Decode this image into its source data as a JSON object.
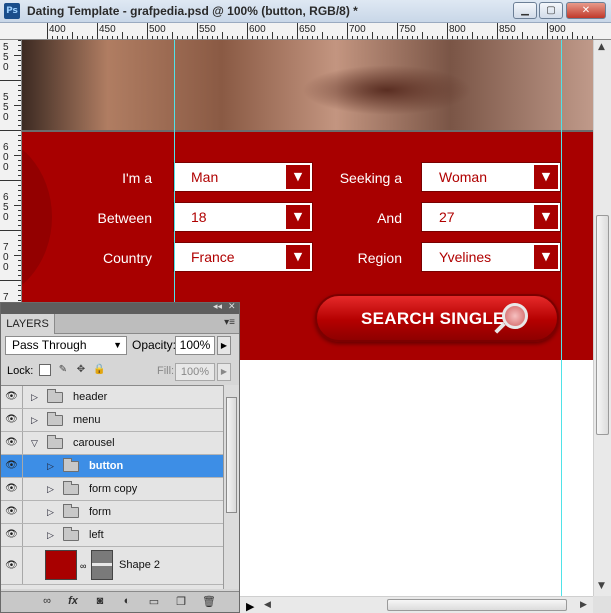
{
  "window": {
    "app_icon": "Ps",
    "title": "Dating Template - grafpedia.psd @ 100% (button, RGB/8) *",
    "controls": [
      "minimize-icon",
      "maximize-icon",
      "close-icon"
    ]
  },
  "ruler": {
    "top_labels": [
      "400",
      "450",
      "500",
      "550",
      "600",
      "650",
      "700",
      "750",
      "800",
      "850",
      "900"
    ],
    "left_labels": [
      "5",
      "5",
      "0",
      "5",
      "5",
      "0",
      "6",
      "0",
      "0",
      "6",
      "5",
      "0",
      "7",
      "0",
      "0",
      "7",
      "5",
      "0"
    ]
  },
  "form": {
    "iam_label": "I'm a",
    "iam_value": "Man",
    "seeking_label": "Seeking a",
    "seeking_value": "Woman",
    "between_label": "Between",
    "between_value": "18",
    "and_label": "And",
    "and_value": "27",
    "country_label": "Country",
    "country_value": "France",
    "region_label": "Region",
    "region_value": "Yvelines",
    "search_button": "SEARCH SINGLE"
  },
  "colors": {
    "panel_red": "#a80000",
    "guide": "#4fe3e8",
    "layer_selected": "#3d8ee6"
  },
  "layers_panel": {
    "tab": "LAYERS",
    "blend_mode": "Pass Through",
    "opacity_label": "Opacity:",
    "opacity_value": "100%",
    "lock_label": "Lock:",
    "fill_label": "Fill:",
    "fill_value": "100%",
    "layers": [
      {
        "name": "header",
        "type": "group",
        "expanded": false,
        "indent": 0,
        "selected": false
      },
      {
        "name": "menu",
        "type": "group",
        "expanded": false,
        "indent": 0,
        "selected": false
      },
      {
        "name": "carousel",
        "type": "group",
        "expanded": true,
        "indent": 0,
        "selected": false
      },
      {
        "name": "button",
        "type": "group",
        "expanded": false,
        "indent": 1,
        "selected": true
      },
      {
        "name": "form copy",
        "type": "group",
        "expanded": false,
        "indent": 1,
        "selected": false
      },
      {
        "name": "form",
        "type": "group",
        "expanded": false,
        "indent": 1,
        "selected": false
      },
      {
        "name": "left",
        "type": "group",
        "expanded": false,
        "indent": 1,
        "selected": false
      },
      {
        "name": "Shape 2",
        "type": "shape",
        "indent": 0,
        "selected": false
      }
    ],
    "bottom_icons": [
      "link-icon",
      "fx-icon",
      "mask-icon",
      "adjustment-icon",
      "new-group-icon",
      "new-layer-icon",
      "trash-icon"
    ]
  }
}
